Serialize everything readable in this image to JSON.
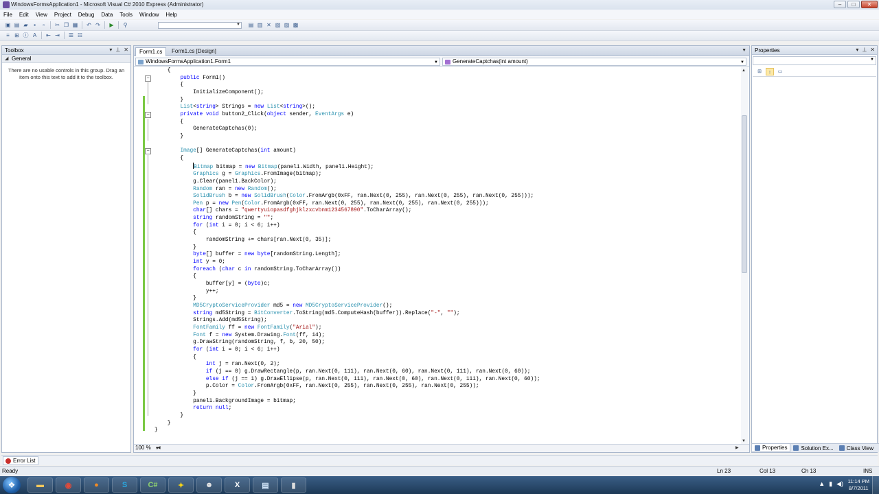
{
  "window": {
    "title": "WindowsFormsApplication1 - Microsoft Visual C# 2010 Express (Administrator)",
    "controls": {
      "minimize": "–",
      "maximize": "□",
      "close": "✕"
    }
  },
  "menu": [
    "File",
    "Edit",
    "View",
    "Project",
    "Debug",
    "Data",
    "Tools",
    "Window",
    "Help"
  ],
  "toolbox": {
    "title": "Toolbox",
    "group": "General",
    "message": "There are no usable controls in this group. Drag an item onto this text to add it to the toolbox."
  },
  "editor": {
    "tabs": [
      {
        "label": "Form1.cs",
        "active": true
      },
      {
        "label": "Form1.cs [Design]",
        "active": false
      }
    ],
    "nav_left": "WindowsFormsApplication1.Form1",
    "nav_right": "GenerateCaptchas(int amount)",
    "zoom": "100 %"
  },
  "properties": {
    "title": "Properties",
    "object_selector": ""
  },
  "bottom_tabs": [
    "Properties",
    "Solution Ex...",
    "Class View"
  ],
  "error_list": {
    "label": "Error List"
  },
  "status": {
    "text": "Ready",
    "ln": "Ln 23",
    "col": "Col 13",
    "ch": "Ch 13",
    "mode": "INS"
  },
  "taskbar": {
    "icons": [
      "explorer-icon",
      "chrome-icon",
      "firefox-icon",
      "skype-icon",
      "visual-csharp-icon",
      "aim-icon",
      "gimp-icon",
      "dxtory-icon",
      "notepad-icon",
      "app-icon"
    ],
    "clock_time": "11:14 PM",
    "clock_date": "8/7/2011"
  },
  "colors": {
    "keyword": "#0000ff",
    "type": "#2b91af",
    "string": "#a31515",
    "changed_margin": "#7ac943",
    "taskbar": "#1d3956"
  }
}
